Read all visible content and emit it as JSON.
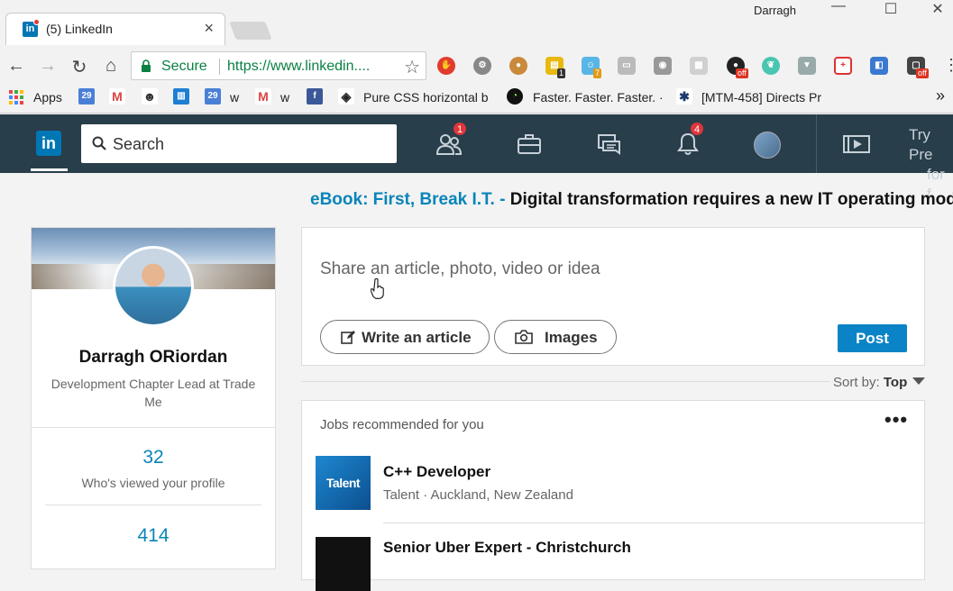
{
  "browser": {
    "tab_title": "(5) LinkedIn",
    "tab_close": "×",
    "user": "Darragh",
    "secure_label": "Secure",
    "url": "https://www.linkedin....",
    "bookmarks": {
      "apps": "Apps",
      "w1": "w",
      "w2": "w",
      "pure_css": "Pure CSS horizontal b",
      "faster": "Faster. Faster. Faster. ·",
      "mtm": "[MTM-458] Directs Pr",
      "more": "»"
    },
    "ext_badges": {
      "b1": "1",
      "b7": "7",
      "off1": "off",
      "off2": "off"
    }
  },
  "nav": {
    "search_placeholder": "Search",
    "network_badge": "1",
    "notifications_badge": "4",
    "try_premium_line1": "Try Pre",
    "try_premium_line2": "for f"
  },
  "ad": {
    "link": "eBook: First, Break I.T. -",
    "text": " Digital transformation requires a new IT operating mode"
  },
  "profile": {
    "name": "Darragh ORiordan",
    "headline": "Development Chapter Lead at Trade Me",
    "views_count": "32",
    "views_label": "Who's viewed your profile",
    "second_count": "414"
  },
  "share": {
    "prompt": "Share an article, photo, video or idea",
    "write_article": "Write an article",
    "images": "Images",
    "post": "Post"
  },
  "sort": {
    "label": "Sort by:",
    "value": "Top"
  },
  "jobs": {
    "title": "Jobs recommended for you",
    "more": "•••",
    "items": [
      {
        "name": "C++ Developer",
        "company": "Talent · Auckland, New Zealand",
        "logo_text": "Talent"
      },
      {
        "name": "Senior Uber Expert - Christchurch"
      }
    ]
  }
}
